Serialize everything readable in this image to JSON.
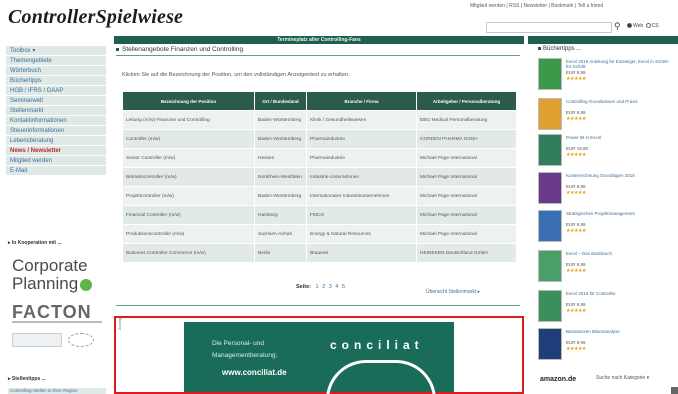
{
  "logo": "ControllerSpielwiese",
  "toplinks": "Mitglied werden | RSS | Newsletter | Bookmark | Tell a friend",
  "search": {
    "options": [
      "Web",
      "CS"
    ]
  },
  "topbar_title": "Termineplatz aller Controlling-Fans",
  "leftnav": [
    {
      "label": "Toolbox ▾"
    },
    {
      "label": "Themengebiete"
    },
    {
      "label": "Wörterbuch"
    },
    {
      "label": "Büchertipps"
    },
    {
      "label": "HGB / IFRS / GAAP"
    },
    {
      "label": "Seminarwelt"
    },
    {
      "label": "Stellenmarkt"
    },
    {
      "label": "Kontaktinformationen"
    },
    {
      "label": "Steuerinformationen"
    },
    {
      "label": "Lebensberatung"
    },
    {
      "label": "News / Newsletter",
      "hot": true
    },
    {
      "label": "Mitglied werden"
    },
    {
      "label": "E-Mail"
    }
  ],
  "sidebar": {
    "partners_heading": "▸ In Kooperation mit ...",
    "corporate_planning_line1": "Corporate",
    "corporate_planning_line2": "Planning",
    "facton": "FACTON",
    "stellenangebote_heading": "▸ Stellentipps ...",
    "stellen_link": "Controlling-Stellen in Ihrer Region"
  },
  "main": {
    "title": "Stellenangebote Finanzen und Controlling",
    "intro": "Klicken Sie auf die Bezeichnung der Position, um den vollständigen Anzeigentext zu erhalten.",
    "headers": [
      "Bezeichnung der Position",
      "Ort / Bundesland",
      "Branche / Firma",
      "Arbeitgeber / Personalberatung"
    ],
    "rows": [
      [
        "Leitung (m/w) Finanzen und Controlling",
        "Baden-Württemberg",
        "Klinik / Gesundheitswesen",
        "EBG Medical Personalberatung"
      ],
      [
        "Controller (m/w)",
        "Baden-Württemberg",
        "Pharmaindustrie",
        "CORDEN PHARMA GmbH"
      ],
      [
        "Senior Controller (m/w)",
        "Hessen",
        "Pharmaindustrie",
        "Michael Page International"
      ],
      [
        "Betriebscontroller (m/w)",
        "Nordrhein-Westfalen",
        "Industrie-Unternehmen",
        "Michael Page International"
      ],
      [
        "Projektcontroller (m/w)",
        "Baden-Württemberg",
        "Internationales Industrieunternehmen",
        "Michael Page International"
      ],
      [
        "Financial Controller (m/w)",
        "Hamburg",
        "FMCG",
        "Michael Page International"
      ],
      [
        "Produktionscontroller (m/w)",
        "Sachsen-Anhalt",
        "Energy & Natural Resources",
        "Michael Page International"
      ],
      [
        "Business Controller Commerce (m/w)",
        "Berlin",
        "Brauerei",
        "HEINEKEN Deutschland GmbH"
      ]
    ],
    "pager_label": "Seite:",
    "pages": [
      "1",
      "2",
      "3",
      "4",
      "5"
    ],
    "more_link": "Übersicht Stellenmarkt ▸"
  },
  "ad": {
    "label": "Anzeige",
    "line1": "Die Personal- und",
    "line2": "Managementberatung.",
    "url": "www.conciliat.de",
    "brand": "conciliat"
  },
  "right": {
    "heading": "Büchertipps ...",
    "books": [
      {
        "title": "Excel 2016 Anleitung für Einsteiger, Excel in Schritt-für-Schritt",
        "price": "EUR 9,99",
        "cover": "#3a9a4a"
      },
      {
        "title": "Controlling-Grundwissen und Praxis",
        "price": "EUR 9,99",
        "cover": "#e0a030"
      },
      {
        "title": "Power BI in Excel",
        "price": "EUR 19,90",
        "cover": "#2f7d5a"
      },
      {
        "title": "Kostenrechnung Grundlagen 2018",
        "price": "EUR 9,99",
        "cover": "#6a3a8a"
      },
      {
        "title": "Strategisches Projektmanagement",
        "price": "EUR 9,99",
        "cover": "#3b6fb3"
      },
      {
        "title": "Excel – Das Basisbuch",
        "price": "EUR 9,99",
        "cover": "#4ba06a"
      },
      {
        "title": "Excel 2016 für Controller",
        "price": "EUR 9,99",
        "cover": "#3a8f5a"
      },
      {
        "title": "Basiswissen Bilanzanalyse",
        "price": "EUR 9,99",
        "cover": "#1f3f7a"
      }
    ],
    "amazon": "amazon.de",
    "amazon_search": "Suche nach Kategorie ▾"
  }
}
